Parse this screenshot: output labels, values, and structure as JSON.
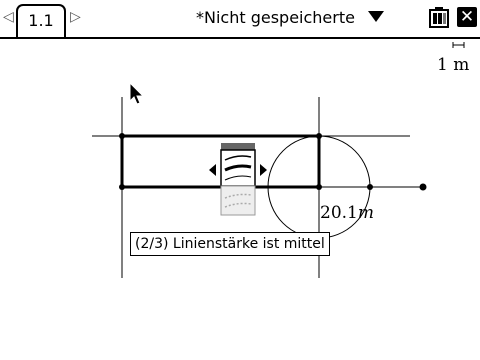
{
  "tab": {
    "label": "1.1"
  },
  "document": {
    "title": "*Nicht gespeicherte"
  },
  "scale": {
    "label": "1 m"
  },
  "measurement": {
    "value": "20.1",
    "unit": "m"
  },
  "tooltip": {
    "text": "(2/3) Linienstärke ist mittel"
  },
  "icons": [
    "tab-left-arrow-icon",
    "tab-right-arrow-icon",
    "dropdown-caret-icon",
    "battery-icon",
    "close-icon",
    "pointer-cursor-icon",
    "line-weight-tool-icon"
  ]
}
